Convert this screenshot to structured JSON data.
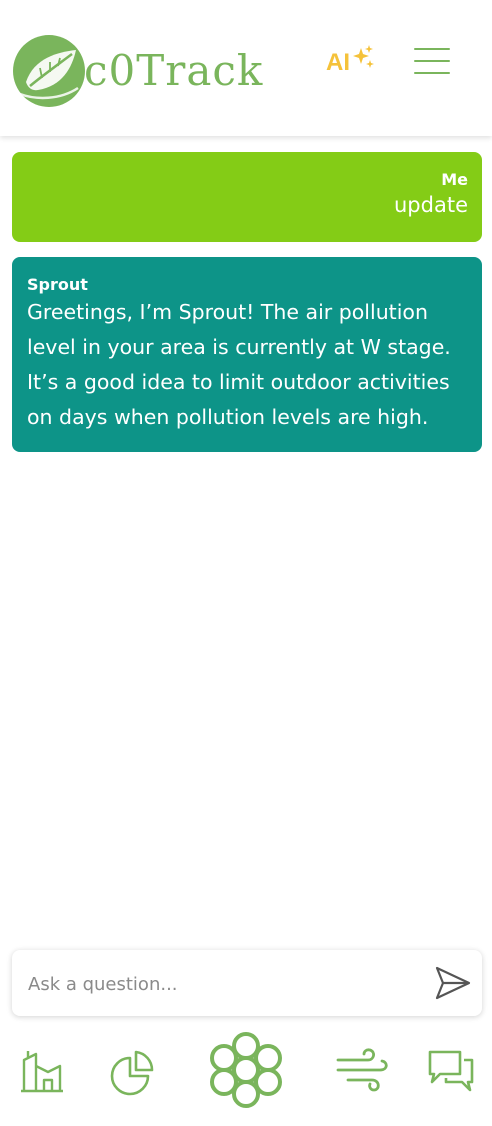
{
  "app": {
    "logo_text": "c0Track",
    "ai_label": "AI",
    "accent_green": "#7ab55c",
    "ai_color": "#f5c23a"
  },
  "chat": {
    "messages": [
      {
        "sender": "Me",
        "text": "update",
        "bubble_color": "#84cc16"
      },
      {
        "sender": "Sprout",
        "text": "Greetings, I’m Sprout! The air pollution level in your area is currently at W stage. It’s a good idea to limit outdoor activities on days when pollution levels are high.",
        "bubble_color": "#0d9488"
      }
    ]
  },
  "input": {
    "placeholder": "Ask a question...",
    "value": ""
  },
  "icons": {
    "menu": "hamburger-menu-icon",
    "ai": "sparkles-icon",
    "send": "send-icon",
    "nav": [
      "home-icon",
      "pie-chart-icon",
      "flower-icon",
      "wind-icon",
      "chat-icon"
    ]
  }
}
